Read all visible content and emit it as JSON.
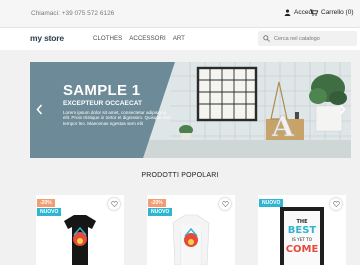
{
  "topbar": {
    "contact": "Chiamaci: +39 075 572 6126",
    "account_label": "Accedi",
    "cart_label": "Carrello (0)"
  },
  "header": {
    "logo_part1": "my",
    "logo_part2": "store",
    "nav": [
      "CLOTHES",
      "ACCESSORI",
      "ART"
    ],
    "search_placeholder": "Cerca nel catalogo"
  },
  "hero": {
    "title": "SAMPLE 1",
    "subtitle": "EXCEPTEUR OCCAECAT",
    "body": "Lorem ipsum dolor sit amet, consectetur adipiscing elit. Proin tristique in tortor et dignissim. Quisque non tempor leo. Maecenas egestas sem elit",
    "prev_icon": "chevron-left-icon",
    "next_icon": "chevron-right-icon"
  },
  "products": {
    "section_title": "PRODOTTI POPOLARI",
    "items": [
      {
        "discount": "-20%",
        "flag": "NUOVO"
      },
      {
        "discount": "-20%",
        "flag": "NUOVO"
      },
      {
        "discount": "",
        "flag": "NUOVO",
        "poster_line1": "THE",
        "poster_line2": "BEST",
        "poster_line3": "IS YET TO",
        "poster_line4": "COME"
      }
    ]
  },
  "colors": {
    "accent": "#2fb5d2",
    "discount": "#f39d72",
    "hero_band": "#6c8a97"
  }
}
